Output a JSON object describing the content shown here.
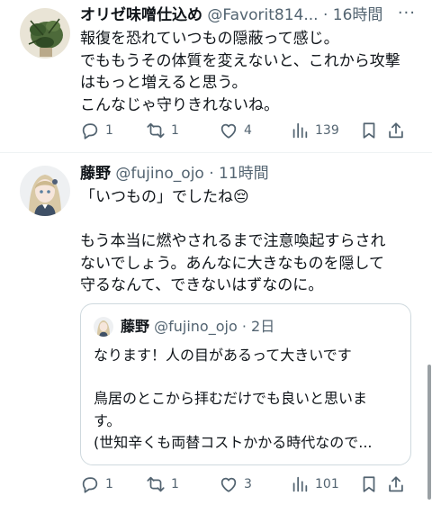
{
  "tweets": [
    {
      "name": "オリゼ味噌仕込め",
      "handle": "@Favorit814...",
      "sep": "·",
      "time": "16時間",
      "more": "···",
      "lines": [
        "報復を恐れていつもの隠蔽って感じ。",
        "でももうその体質を変えないと、これから攻撃",
        "はもっと増えると思う。",
        "こんなじゃ守りきれないね。"
      ],
      "actions": {
        "replies": "1",
        "retweets": "1",
        "likes": "4",
        "views": "139"
      }
    },
    {
      "name": "藤野",
      "handle": "@fujino_ojo",
      "sep": "·",
      "time": "11時間",
      "lines": [
        "「いつもの」でしたね😔",
        "",
        "もう本当に燃やされるまで注意喚起すらされ",
        "ないでしょう。あんなに大きなものを隠して",
        "守るなんて、できないはずなのに。"
      ],
      "quote": {
        "name": "藤野",
        "handle": "@fujino_ojo",
        "sep": "·",
        "time": "2日",
        "lines": [
          "なります！人の目があるって大きいです",
          "",
          "鳥居のとこから拝むだけでも良いと思いま",
          "す。",
          "(世知辛くも両替コストかかる時代なので..."
        ]
      },
      "actions": {
        "replies": "1",
        "retweets": "1",
        "likes": "3",
        "views": "101"
      }
    }
  ],
  "icons": [
    "reply-icon",
    "retweet-icon",
    "like-icon",
    "views-icon",
    "bookmark-icon",
    "share-icon"
  ],
  "colors": {
    "text": "#0f1419",
    "secondary": "#536471",
    "border": "#cfd9de"
  }
}
